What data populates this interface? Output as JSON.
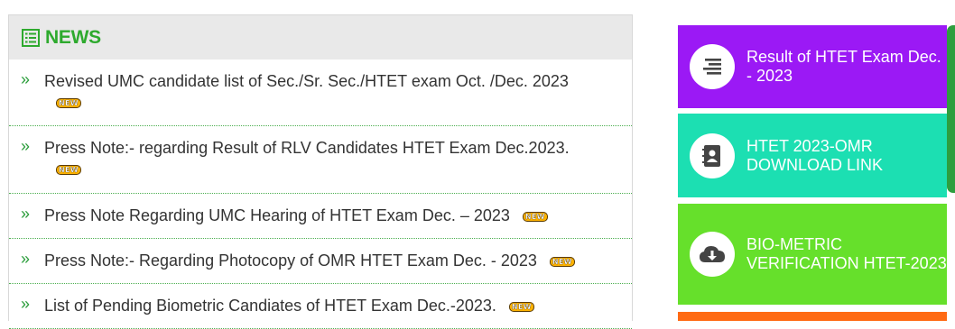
{
  "news": {
    "title": "NEWS",
    "badge": "NEW",
    "items": [
      {
        "text": "Revised UMC candidate list of Sec./Sr. Sec./HTET exam Oct. /Dec. 2023"
      },
      {
        "text": "Press Note:- regarding Result of RLV Candidates HTET Exam Dec.2023."
      },
      {
        "text": "Press Note Regarding UMC Hearing of HTET Exam Dec. – 2023"
      },
      {
        "text": "Press Note:- Regarding Photocopy of OMR HTET Exam Dec. - 2023"
      },
      {
        "text": "List of Pending Biometric Candiates of HTET Exam Dec.-2023."
      }
    ]
  },
  "sidebar": {
    "cards": [
      {
        "label": "Result of HTET Exam Dec. - 2023",
        "icon": "list-icon",
        "color": "#9b19f5"
      },
      {
        "label": "HTET 2023-OMR DOWNLOAD LINK",
        "icon": "contact-book-icon",
        "color": "#1cdfb2"
      },
      {
        "label": "BIO-METRIC VERIFICATION HTET-2023",
        "icon": "cloud-download-icon",
        "color": "#66e02b"
      }
    ]
  },
  "colors": {
    "accent": "#2eaa2e",
    "next_card": "#ff6a13"
  }
}
